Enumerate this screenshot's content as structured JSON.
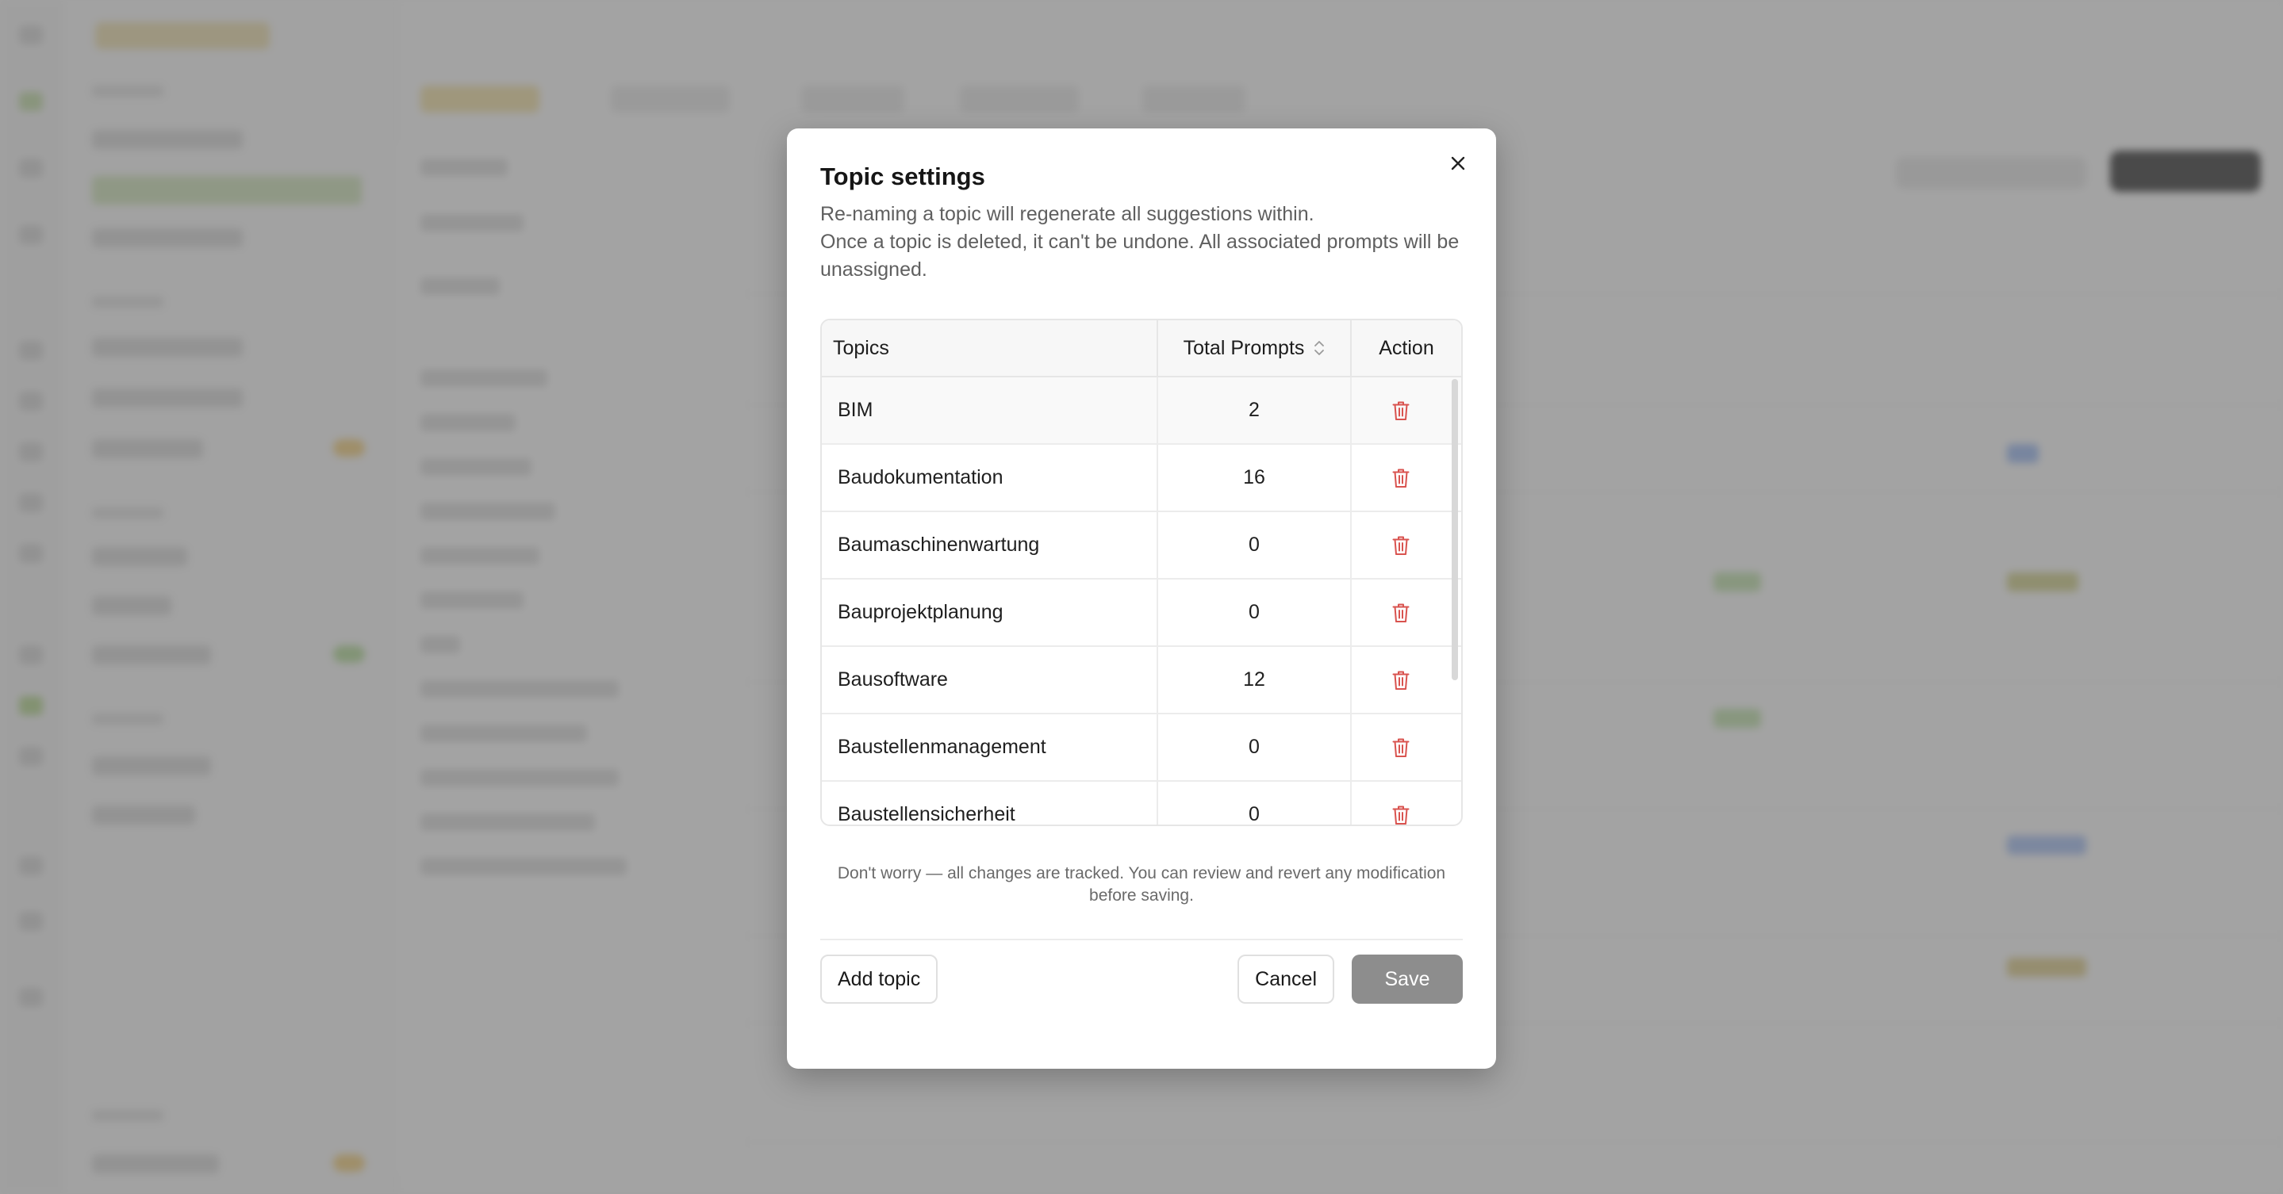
{
  "modal": {
    "title": "Topic settings",
    "description": [
      "Re-naming a topic will regenerate all suggestions within.",
      "Once a topic is deleted, it can't be undone. All associated prompts will be unassigned."
    ],
    "table": {
      "headers": {
        "topics": "Topics",
        "total_prompts": "Total Prompts",
        "action": "Action"
      },
      "rows": [
        {
          "topic": "BIM",
          "total_prompts": "2"
        },
        {
          "topic": "Baudokumentation",
          "total_prompts": "16"
        },
        {
          "topic": "Baumaschinenwartung",
          "total_prompts": "0"
        },
        {
          "topic": "Bauprojektplanung",
          "total_prompts": "0"
        },
        {
          "topic": "Bausoftware",
          "total_prompts": "12"
        },
        {
          "topic": "Baustellenmanagement",
          "total_prompts": "0"
        },
        {
          "topic": "Baustellensicherheit",
          "total_prompts": "0"
        }
      ]
    },
    "note": "Don't worry — all changes are tracked. You can review and revert any modification before saving.",
    "buttons": {
      "add_topic": "Add topic",
      "cancel": "Cancel",
      "save": "Save"
    }
  },
  "colors": {
    "trash_icon": "#d9534f",
    "save_button_disabled": "#8d8d8d",
    "overlay": "rgba(105,105,105,0.6)"
  },
  "icons": {
    "close": "close-icon",
    "sort": "sort-icon",
    "delete": "trash-icon"
  }
}
